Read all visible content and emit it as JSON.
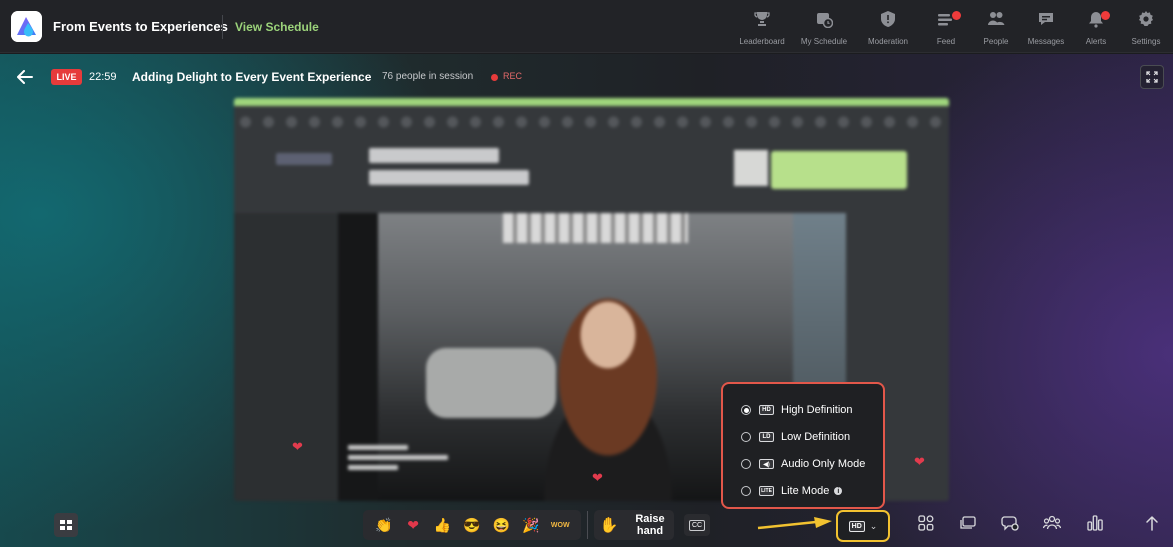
{
  "header": {
    "event_title": "From Events to Experiences",
    "view_schedule": "View Schedule",
    "nav": [
      {
        "label": "Leaderboard",
        "icon": "trophy-icon"
      },
      {
        "label": "My Schedule",
        "icon": "calendar-clock-icon"
      },
      {
        "label": "Moderation",
        "icon": "shield-icon"
      },
      {
        "label": "Feed",
        "icon": "feed-icon",
        "badge": true
      },
      {
        "label": "People",
        "icon": "people-icon"
      },
      {
        "label": "Messages",
        "icon": "messages-icon"
      },
      {
        "label": "Alerts",
        "icon": "bell-icon",
        "badge": true
      },
      {
        "label": "Settings",
        "icon": "gear-icon"
      }
    ]
  },
  "session": {
    "live_label": "LIVE",
    "time": "22:59",
    "title": "Adding Delight to Every Event Experience",
    "people_count": "76 people in session",
    "rec_label": "REC"
  },
  "quality_menu": {
    "options": [
      {
        "label": "High Definition",
        "icon_text": "HD",
        "selected": true
      },
      {
        "label": "Low Definition",
        "icon_text": "LD",
        "selected": false
      },
      {
        "label": "Audio Only Mode",
        "icon_text": "◀)",
        "selected": false
      },
      {
        "label": "Lite Mode",
        "icon_text": "LITE",
        "selected": false,
        "info": true
      }
    ]
  },
  "bottom": {
    "emojis": [
      "👏",
      "❤",
      "👍",
      "😎",
      "😆",
      "🎉",
      "WOW"
    ],
    "raise_hand": "Raise\nhand",
    "cc_label": "CC",
    "quality_current": "HD",
    "tools": [
      "apps-icon",
      "slides-icon",
      "qna-icon",
      "groups-icon",
      "poll-icon",
      "expand-up-icon"
    ]
  },
  "colors": {
    "accent_green": "#9bd27a",
    "live_red": "#e63b3b",
    "menu_border": "#e2574a",
    "highlight_yellow": "#f2c230"
  }
}
